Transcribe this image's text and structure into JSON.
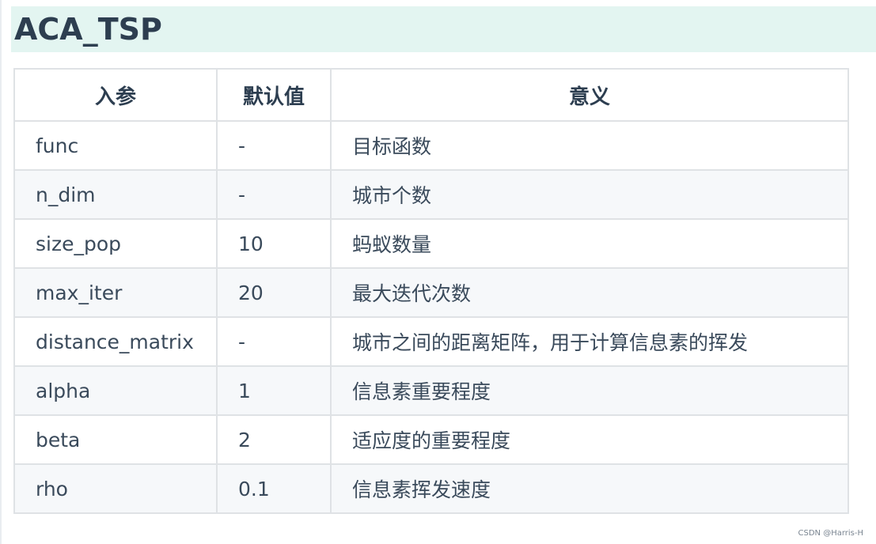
{
  "section": {
    "title": "ACA_TSP"
  },
  "table": {
    "headers": [
      "入参",
      "默认值",
      "意义"
    ],
    "rows": [
      [
        "func",
        "-",
        "目标函数"
      ],
      [
        "n_dim",
        "-",
        "城市个数"
      ],
      [
        "size_pop",
        "10",
        "蚂蚁数量"
      ],
      [
        "max_iter",
        "20",
        "最大迭代次数"
      ],
      [
        "distance_matrix",
        "-",
        "城市之间的距离矩阵，用于计算信息素的挥发"
      ],
      [
        "alpha",
        "1",
        "信息素重要程度"
      ],
      [
        "beta",
        "2",
        "适应度的重要程度"
      ],
      [
        "rho",
        "0.1",
        "信息素挥发速度"
      ]
    ]
  },
  "watermark": "CSDN @Harris-H"
}
